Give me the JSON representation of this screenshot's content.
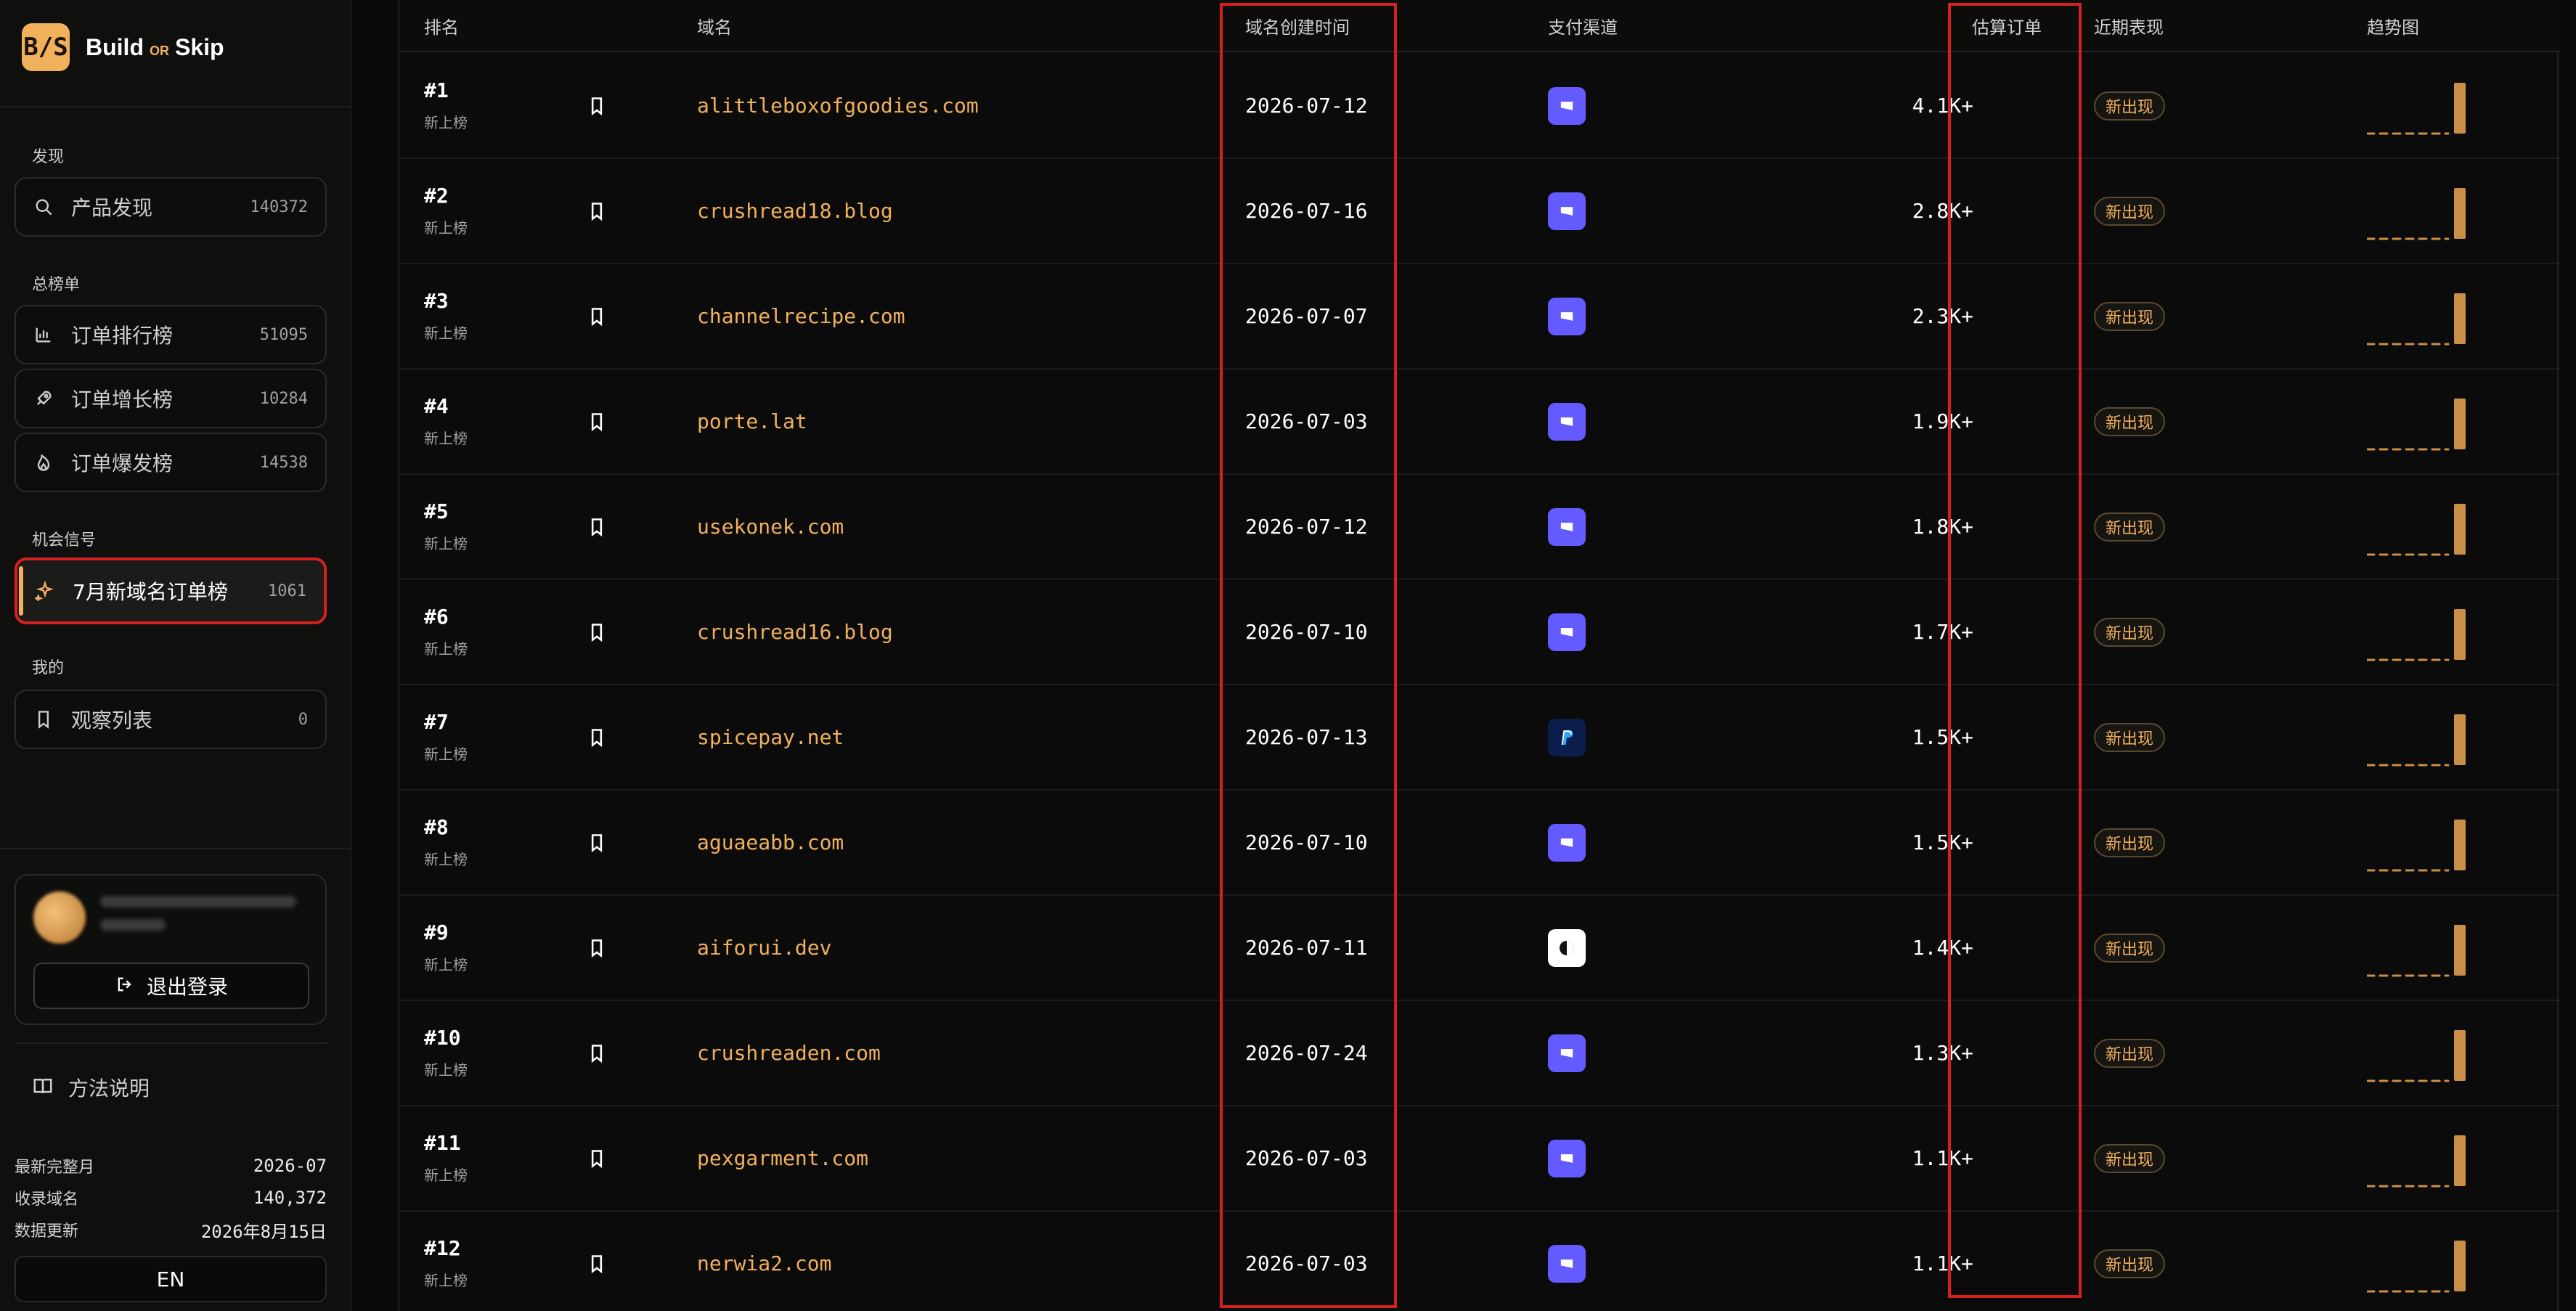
{
  "sidebar": {
    "logo": {
      "mark": "B/S",
      "brand_left": "Build",
      "brand_mid": "OR",
      "brand_right": "Skip"
    },
    "sections": {
      "discover": "发现",
      "overall": "总榜单",
      "signals": "机会信号",
      "mine": "我的"
    },
    "nav": {
      "product_discovery": {
        "label": "产品发现",
        "count": "140372"
      },
      "orders_rank": {
        "label": "订单排行榜",
        "count": "51095"
      },
      "growth_rank": {
        "label": "订单增长榜",
        "count": "10284"
      },
      "burst_rank": {
        "label": "订单爆发榜",
        "count": "14538"
      },
      "july_new_domains": {
        "label": "7月新域名订单榜",
        "count": "1061"
      },
      "watchlist": {
        "label": "观察列表",
        "count": "0"
      }
    },
    "user": {
      "logout_label": "退出登录"
    },
    "method_label": "方法说明",
    "stats": [
      {
        "k": "最新完整月",
        "v": "2026-07"
      },
      {
        "k": "收录域名",
        "v": "140,372"
      },
      {
        "k": "数据更新",
        "v": "2026年8月15日"
      }
    ],
    "lang_label": "EN"
  },
  "table": {
    "headers": {
      "rank": "排名",
      "domain": "域名",
      "created": "域名创建时间",
      "payment": "支付渠道",
      "orders": "估算订单",
      "recent": "近期表现",
      "trend": "趋势图"
    },
    "rows": [
      {
        "rank": "#1",
        "sub": "新上榜",
        "domain": "alittleboxofgoodies.com",
        "created": "2026-07-12",
        "payment": "stripe",
        "orders": "4.1K+",
        "recent": "新出现"
      },
      {
        "rank": "#2",
        "sub": "新上榜",
        "domain": "crushread18.blog",
        "created": "2026-07-16",
        "payment": "stripe",
        "orders": "2.8K+",
        "recent": "新出现"
      },
      {
        "rank": "#3",
        "sub": "新上榜",
        "domain": "channelrecipe.com",
        "created": "2026-07-07",
        "payment": "stripe",
        "orders": "2.3K+",
        "recent": "新出现"
      },
      {
        "rank": "#4",
        "sub": "新上榜",
        "domain": "porte.lat",
        "created": "2026-07-03",
        "payment": "stripe",
        "orders": "1.9K+",
        "recent": "新出现"
      },
      {
        "rank": "#5",
        "sub": "新上榜",
        "domain": "usekonek.com",
        "created": "2026-07-12",
        "payment": "stripe",
        "orders": "1.8K+",
        "recent": "新出现"
      },
      {
        "rank": "#6",
        "sub": "新上榜",
        "domain": "crushread16.blog",
        "created": "2026-07-10",
        "payment": "stripe",
        "orders": "1.7K+",
        "recent": "新出现"
      },
      {
        "rank": "#7",
        "sub": "新上榜",
        "domain": "spicepay.net",
        "created": "2026-07-13",
        "payment": "paypal",
        "orders": "1.5K+",
        "recent": "新出现"
      },
      {
        "rank": "#8",
        "sub": "新上榜",
        "domain": "aguaeabb.com",
        "created": "2026-07-10",
        "payment": "stripe",
        "orders": "1.5K+",
        "recent": "新出现"
      },
      {
        "rank": "#9",
        "sub": "新上榜",
        "domain": "aiforui.dev",
        "created": "2026-07-11",
        "payment": "other",
        "orders": "1.4K+",
        "recent": "新出现"
      },
      {
        "rank": "#10",
        "sub": "新上榜",
        "domain": "crushreaden.com",
        "created": "2026-07-24",
        "payment": "stripe",
        "orders": "1.3K+",
        "recent": "新出现"
      },
      {
        "rank": "#11",
        "sub": "新上榜",
        "domain": "pexgarment.com",
        "created": "2026-07-03",
        "payment": "stripe",
        "orders": "1.1K+",
        "recent": "新出现"
      },
      {
        "rank": "#12",
        "sub": "新上榜",
        "domain": "nerwia2.com",
        "created": "2026-07-03",
        "payment": "stripe",
        "orders": "1.1K+",
        "recent": "新出现"
      }
    ]
  },
  "colors": {
    "accent": "#f1b05c",
    "accent_dark": "#c98f47",
    "highlight_border": "#d61f1f",
    "stripe": "#635bff",
    "paypal": "#0b1d4b"
  }
}
